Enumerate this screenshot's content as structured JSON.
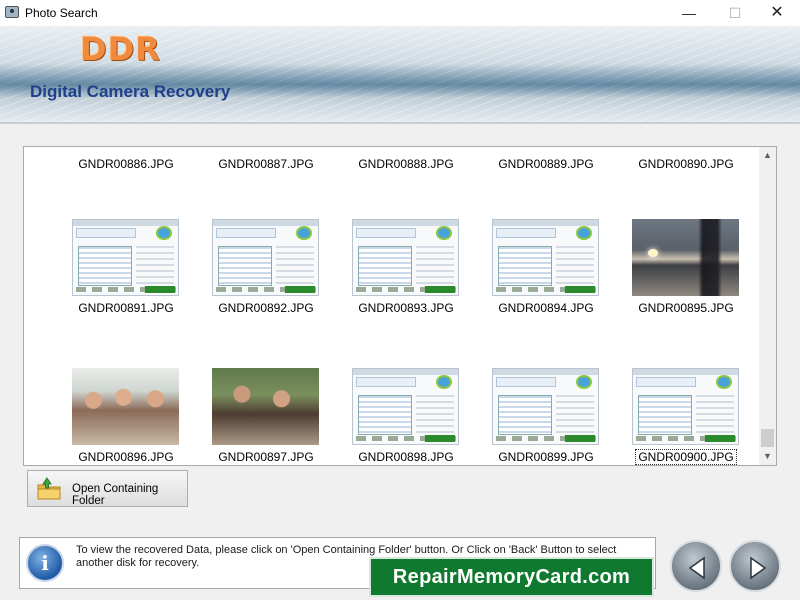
{
  "window": {
    "title": "Photo Search",
    "minimize_glyph": "—",
    "maximize_glyph": "☐",
    "close_glyph": "✕"
  },
  "banner": {
    "logo": "DDR",
    "product_name": "Digital Camera Recovery"
  },
  "grid": {
    "rows": [
      [
        {
          "name": "GNDR00886.JPG",
          "thumb": "none"
        },
        {
          "name": "GNDR00887.JPG",
          "thumb": "none"
        },
        {
          "name": "GNDR00888.JPG",
          "thumb": "none"
        },
        {
          "name": "GNDR00889.JPG",
          "thumb": "none"
        },
        {
          "name": "GNDR00890.JPG",
          "thumb": "none"
        }
      ],
      [
        {
          "name": "GNDR00891.JPG",
          "thumb": "software-screenshot"
        },
        {
          "name": "GNDR00892.JPG",
          "thumb": "software-screenshot"
        },
        {
          "name": "GNDR00893.JPG",
          "thumb": "software-screenshot"
        },
        {
          "name": "GNDR00894.JPG",
          "thumb": "software-screenshot"
        },
        {
          "name": "GNDR00895.JPG",
          "thumb": "photo-train-station"
        }
      ],
      [
        {
          "name": "GNDR00896.JPG",
          "thumb": "photo-girls"
        },
        {
          "name": "GNDR00897.JPG",
          "thumb": "photo-girls-outdoor"
        },
        {
          "name": "GNDR00898.JPG",
          "thumb": "software-screenshot"
        },
        {
          "name": "GNDR00899.JPG",
          "thumb": "software-screenshot"
        },
        {
          "name": "GNDR00900.JPG",
          "thumb": "software-screenshot",
          "selected": true
        }
      ]
    ]
  },
  "actions": {
    "open_folder_label": "Open Containing Folder",
    "open_folder_icon": "folder-icon"
  },
  "info": {
    "icon": "info-icon",
    "message": "To view the recovered Data, please click on 'Open Containing Folder' button. Or Click on 'Back' Button to select another disk for recovery."
  },
  "site": {
    "text": "RepairMemoryCard.com",
    "color": "#0f7a2f"
  },
  "nav": {
    "back_icon": "back-arrow-icon",
    "next_icon": "next-arrow-icon"
  }
}
